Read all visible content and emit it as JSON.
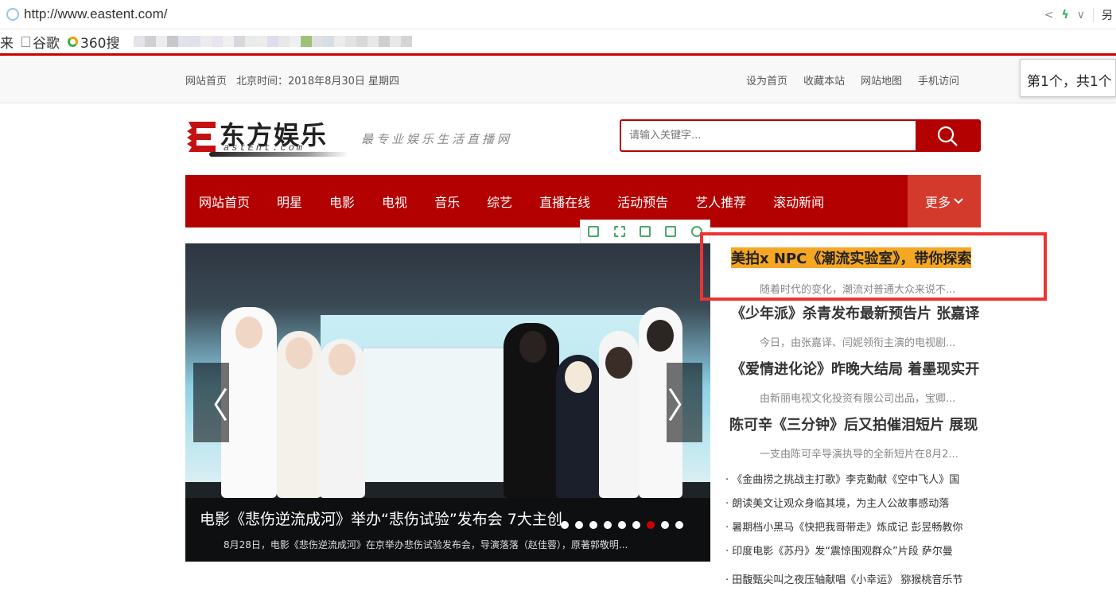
{
  "browser": {
    "url": "http://www.eastent.com/",
    "right_label": "另",
    "bookmarks": [
      {
        "label": "来"
      },
      {
        "label": "谷歌"
      },
      {
        "label": "360搜"
      }
    ]
  },
  "topbar": {
    "home": "网站首页",
    "time": "北京时间：2018年8月30日 星期四",
    "links": [
      "设为首页",
      "收藏本站",
      "网站地图",
      "手机访问"
    ]
  },
  "counter": "第1个，共1个",
  "logo": {
    "title": "东方娱乐",
    "sub": "astEnt.com"
  },
  "slogan": "最专业娱乐生活直播网",
  "search": {
    "placeholder": "请输入关键字..."
  },
  "nav": {
    "items": [
      "网站首页",
      "明星",
      "电影",
      "电视",
      "音乐",
      "综艺",
      "直播在线",
      "活动预告",
      "艺人推荐",
      "滚动新闻"
    ],
    "more": "更多"
  },
  "slider": {
    "title": "电影《悲伤逆流成河》举办“悲伤试验”发布会 7大主创",
    "desc": "8月28日，电影《悲伤逆流成河》在京举办悲伤试验发布会，导演落落（赵佳蓉），原著郭敬明...",
    "prev": "〈",
    "next": "〉",
    "dot_count": 9,
    "active_dot": 7
  },
  "news": [
    {
      "title": "美拍x NPC《潮流实验室》，带你探索",
      "desc": "随着时代的变化，潮流对普通大众来说不...",
      "highlight": true
    },
    {
      "title": "《少年派》杀青发布最新预告片 张嘉译",
      "desc": "今日，由张嘉译、闫妮领衔主演的电视剧..."
    },
    {
      "title": "《爱情进化论》昨晚大结局 着墨现实开",
      "desc": "由新丽电视文化投资有限公司出品，宝卿..."
    },
    {
      "title": "陈可辛《三分钟》后又拍催泪短片 展现",
      "desc": "一支由陈可辛导演执导的全新短片在8月2..."
    }
  ],
  "links": [
    "· 《金曲捞之挑战主打歌》李克勤献《空中飞人》国",
    "· 朗读美文让观众身临其境，为主人公故事感动落",
    "· 暑期档小黑马《快把我哥带走》炼成记 彭昱畅教你",
    "· 印度电影《苏丹》发“震惊围观群众”片段 萨尔曼",
    "· 田馥甄尖叫之夜压轴献唱《小幸运》 猕猴桃音乐节"
  ]
}
